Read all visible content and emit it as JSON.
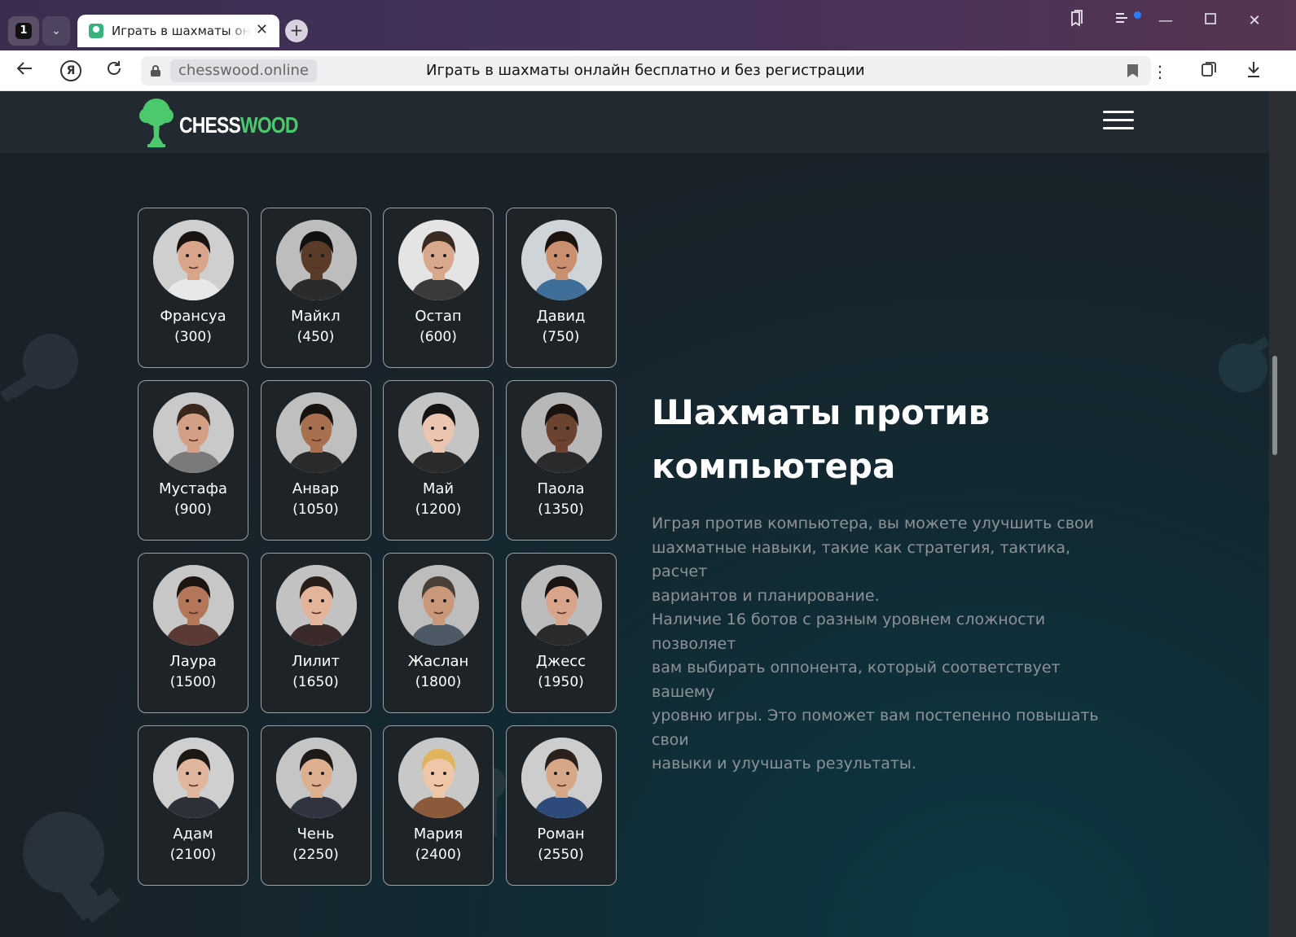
{
  "browser": {
    "tab_count": "1",
    "tab_title": "Играть в шахматы онлайн бесплатно и без регистрации",
    "domain": "chesswood.online",
    "page_title": "Играть в шахматы онлайн бесплатно и без регистрации"
  },
  "site": {
    "logo_white": "CHESS",
    "logo_green": "WOOD",
    "brand_green": "#4cc86d"
  },
  "bots": [
    {
      "name": "Франсуа",
      "rating": "(300)",
      "skin": "#d9a58a",
      "hair": "#1a1410",
      "bg": "#cfcfcf",
      "shirt": "#e8e8e8"
    },
    {
      "name": "Майкл",
      "rating": "(450)",
      "skin": "#5a3a28",
      "hair": "#111111",
      "bg": "#bdbdbd",
      "shirt": "#2b2b2b"
    },
    {
      "name": "Остап",
      "rating": "(600)",
      "skin": "#d8a88c",
      "hair": "#3b2a20",
      "bg": "#e4e4e4",
      "shirt": "#3a3a3a"
    },
    {
      "name": "Давид",
      "rating": "(750)",
      "skin": "#c98f6e",
      "hair": "#1c1410",
      "bg": "#cfd4d8",
      "shirt": "#3f6e99"
    },
    {
      "name": "Мустафа",
      "rating": "(900)",
      "skin": "#d4a085",
      "hair": "#3a281c",
      "bg": "#c9c9c9",
      "shirt": "#7a7a7a"
    },
    {
      "name": "Анвар",
      "rating": "(1050)",
      "skin": "#a8704e",
      "hair": "#161210",
      "bg": "#bfbfbf",
      "shirt": "#2a2a2a"
    },
    {
      "name": "Май",
      "rating": "(1200)",
      "skin": "#ecc5b0",
      "hair": "#151212",
      "bg": "#c4c4c4",
      "shirt": "#2a2a2a"
    },
    {
      "name": "Паола",
      "rating": "(1350)",
      "skin": "#6b4330",
      "hair": "#1a120e",
      "bg": "#b8b8b8",
      "shirt": "#2a2a2a"
    },
    {
      "name": "Лаура",
      "rating": "(1500)",
      "skin": "#b47658",
      "hair": "#1b1410",
      "bg": "#c7c7c7",
      "shirt": "#5a3a32"
    },
    {
      "name": "Лилит",
      "rating": "(1650)",
      "skin": "#e3b39a",
      "hair": "#2a1c16",
      "bg": "#c2c2c2",
      "shirt": "#3a2a2a"
    },
    {
      "name": "Жаслан",
      "rating": "(1800)",
      "skin": "#c9977a",
      "hair": "#4a4038",
      "bg": "#bdbdbd",
      "shirt": "#4d5a66"
    },
    {
      "name": "Джесс",
      "rating": "(1950)",
      "skin": "#d9a58a",
      "hair": "#1a1412",
      "bg": "#bcbcbc",
      "shirt": "#2a2a2a"
    },
    {
      "name": "Адам",
      "rating": "(2100)",
      "skin": "#e0b69c",
      "hair": "#1d1814",
      "bg": "#cfcfcf",
      "shirt": "#2c3038"
    },
    {
      "name": "Чень",
      "rating": "(2250)",
      "skin": "#dcb08f",
      "hair": "#1e1a18",
      "bg": "#c5c5c5",
      "shirt": "#2f3440"
    },
    {
      "name": "Мария",
      "rating": "(2400)",
      "skin": "#f0c6a8",
      "hair": "#e0b45a",
      "bg": "#c8c8c8",
      "shirt": "#8a5a3a"
    },
    {
      "name": "Роман",
      "rating": "(2550)",
      "skin": "#d7a888",
      "hair": "#2a211c",
      "bg": "#cdcdcd",
      "shirt": "#2d4a7a"
    }
  ],
  "hero": {
    "title_line1": "Шахматы против",
    "title_line2": "компьютера",
    "para1_line1": "Играя против компьютера, вы можете улучшить свои",
    "para1_line2": "шахматные навыки, такие как стратегия, тактика, расчет",
    "para1_line3": "вариантов и планирование.",
    "para2_line1": "Наличие 16 ботов с разным уровнем сложности позволяет",
    "para2_line2": "вам выбирать оппонента, который соответствует вашему",
    "para2_line3": "уровню игры. Это поможет вам постепенно повышать свои",
    "para2_line4": "навыки и улучшать результаты."
  }
}
